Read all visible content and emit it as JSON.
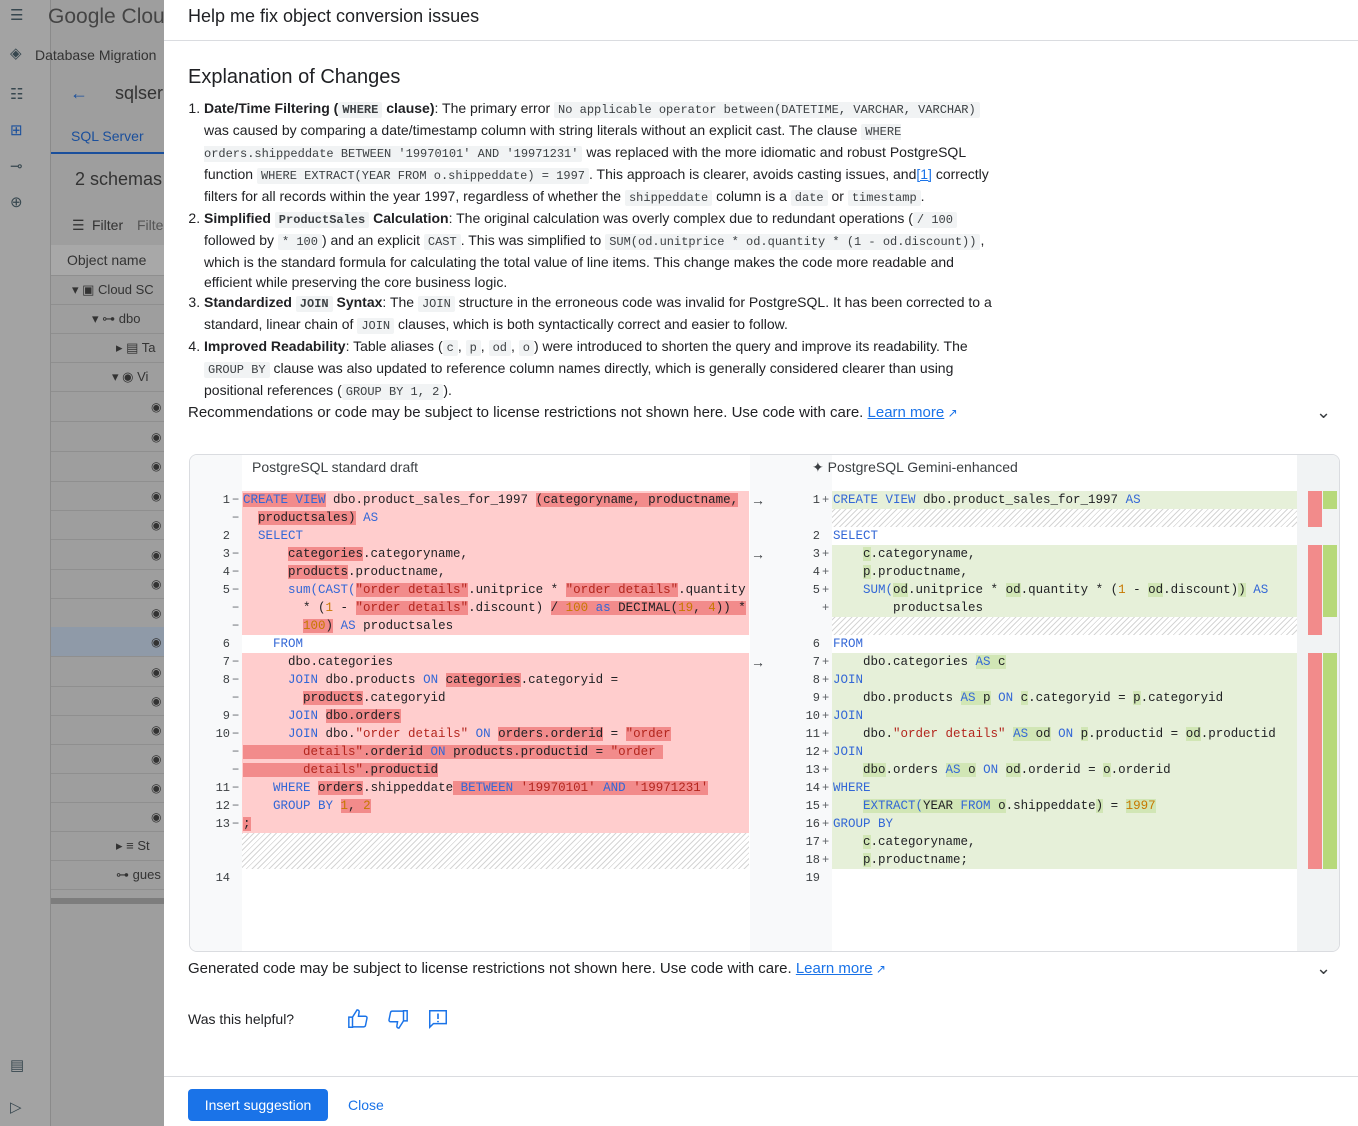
{
  "background": {
    "logo": "Google Cloud",
    "service": "Database Migration",
    "back_label": "sqlser",
    "tab": "SQL Server",
    "schemas": "2 schemas",
    "filter_label": "Filter",
    "filter_placeholder": "Filte",
    "column_header": "Object name",
    "tree": [
      "Cloud SC",
      "dbo",
      "Ta",
      "Vi",
      "St",
      "gues"
    ]
  },
  "panel": {
    "title": "Help me fix object conversion issues",
    "explanation_title": "Explanation of Changes",
    "items": [
      {
        "lead": "Date/Time Filtering (",
        "lead_code": "WHERE",
        "lead_end": " clause)",
        "p1": ": The primary error ",
        "c1": "No applicable operator between(DATETIME, VARCHAR, VARCHAR)",
        "p2": " was caused by comparing a date/timestamp column with string literals without an explicit cast. The clause ",
        "c2": "WHERE orders.shippeddate BETWEEN '19970101' AND '19971231'",
        "p3": " was replaced with the more idiomatic and robust PostgreSQL function ",
        "c3": "WHERE EXTRACT(YEAR FROM o.shippeddate) = 1997",
        "p4": ". This approach is clearer, avoids casting issues, and",
        "cite": "[1]",
        "p5": " correctly filters for all records within the year 1997, regardless of whether the ",
        "c4": "shippeddate",
        "p6": " column is a ",
        "c5": "date",
        "p7": " or ",
        "c6": "timestamp",
        "p8": "."
      },
      {
        "lead": "Simplified ",
        "lead_code": "ProductSales",
        "lead_end": " Calculation",
        "p1": ": The original calculation was overly complex due to redundant operations (",
        "c1": "/ 100",
        "p2": " followed by ",
        "c2": "* 100",
        "p3": ") and an explicit ",
        "c3": "CAST",
        "p4": ". This was simplified to ",
        "c4": "SUM(od.unitprice * od.quantity * (1 - od.discount))",
        "p5": ", which is the standard formula for calculating the total value of line items. This change makes the code more readable and efficient while preserving the core business logic."
      },
      {
        "lead": "Standardized ",
        "lead_code": "JOIN",
        "lead_end": " Syntax",
        "p1": ": The ",
        "c1": "JOIN",
        "p2": " structure in the erroneous code was invalid for PostgreSQL. It has been corrected to a standard, linear chain of ",
        "c2": "JOIN",
        "p3": " clauses, which is both syntactically correct and easier to follow."
      },
      {
        "lead": "Improved Readability",
        "p1": ": Table aliases (",
        "c1": "c",
        "s1": ", ",
        "c2": "p",
        "s2": ", ",
        "c3": "od",
        "s3": ", ",
        "c4": "o",
        "p2": ") were introduced to shorten the query and improve its readability. The ",
        "c5": "GROUP BY",
        "p3": " clause was also updated to reference column names directly, which is generally considered clearer than using positional references (",
        "c6": "GROUP BY 1, 2",
        "p4": ")."
      }
    ],
    "notice1": "Recommendations or code may be subject to license restrictions not shown here. Use code with care.",
    "notice2": "Generated code may be subject to license restrictions not shown here. Use code with care.",
    "learn_more": "Learn more",
    "diff": {
      "left_header": "PostgreSQL standard draft",
      "right_header": "PostgreSQL Gemini-enhanced",
      "left_nums": [
        "1",
        "2",
        "3",
        "4",
        "5",
        "6",
        "7",
        "8",
        "9",
        "10",
        "11",
        "12",
        "13",
        "14"
      ],
      "right_nums": [
        "1",
        "2",
        "3",
        "4",
        "5",
        "6",
        "7",
        "8",
        "9",
        "10",
        "11",
        "12",
        "13",
        "14",
        "15",
        "16",
        "17",
        "18",
        "19"
      ]
    },
    "feedback_label": "Was this helpful?",
    "insert_button": "Insert suggestion",
    "close_button": "Close"
  }
}
